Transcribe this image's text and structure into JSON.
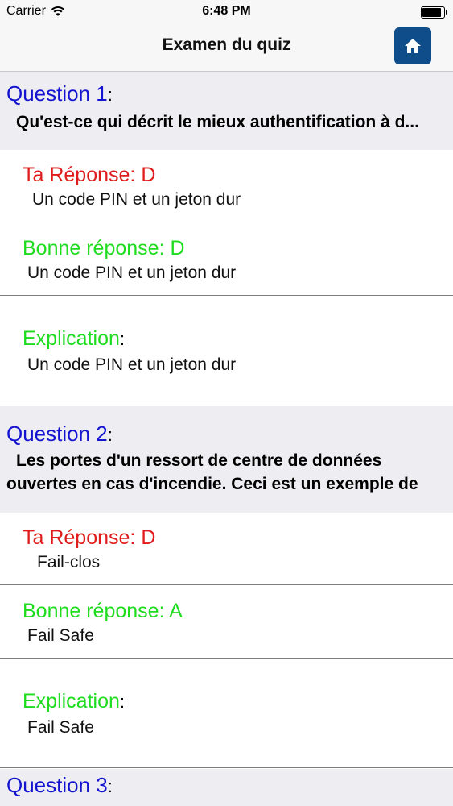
{
  "status_bar": {
    "carrier": "Carrier",
    "time": "6:48 PM",
    "battery_level": 0.95
  },
  "nav": {
    "title": "Examen du quiz",
    "home_icon": "home-icon"
  },
  "questions": [
    {
      "label": "Question 1",
      "colon": ":",
      "text": "Qu'est-ce qui décrit le mieux authentification à d...",
      "your_answer_label": "Ta Réponse: D",
      "your_answer_text": "Un code PIN et un jeton dur",
      "correct_answer_label": "Bonne réponse: D",
      "correct_answer_text": "Un code PIN et un jeton dur",
      "explanation_label": "Explication",
      "explanation_colon": ":",
      "explanation_text": "Un code PIN et un jeton dur"
    },
    {
      "label": "Question 2",
      "colon": ":",
      "text_line1": "Les portes d'un ressort de centre de données",
      "text_line2": "ouvertes en cas d'incendie. Ceci est un exemple de",
      "your_answer_label": "Ta Réponse: D",
      "your_answer_text": "Fail-clos",
      "correct_answer_label": "Bonne réponse: A",
      "correct_answer_text": "Fail Safe",
      "explanation_label": "Explication",
      "explanation_colon": ":",
      "explanation_text": "Fail Safe"
    },
    {
      "label": "Question 3",
      "colon": ":"
    }
  ],
  "colors": {
    "question_blue": "#1414d0",
    "wrong_red": "#e01b1b",
    "correct_green": "#1edc1e",
    "home_button": "#0f4c8a"
  }
}
